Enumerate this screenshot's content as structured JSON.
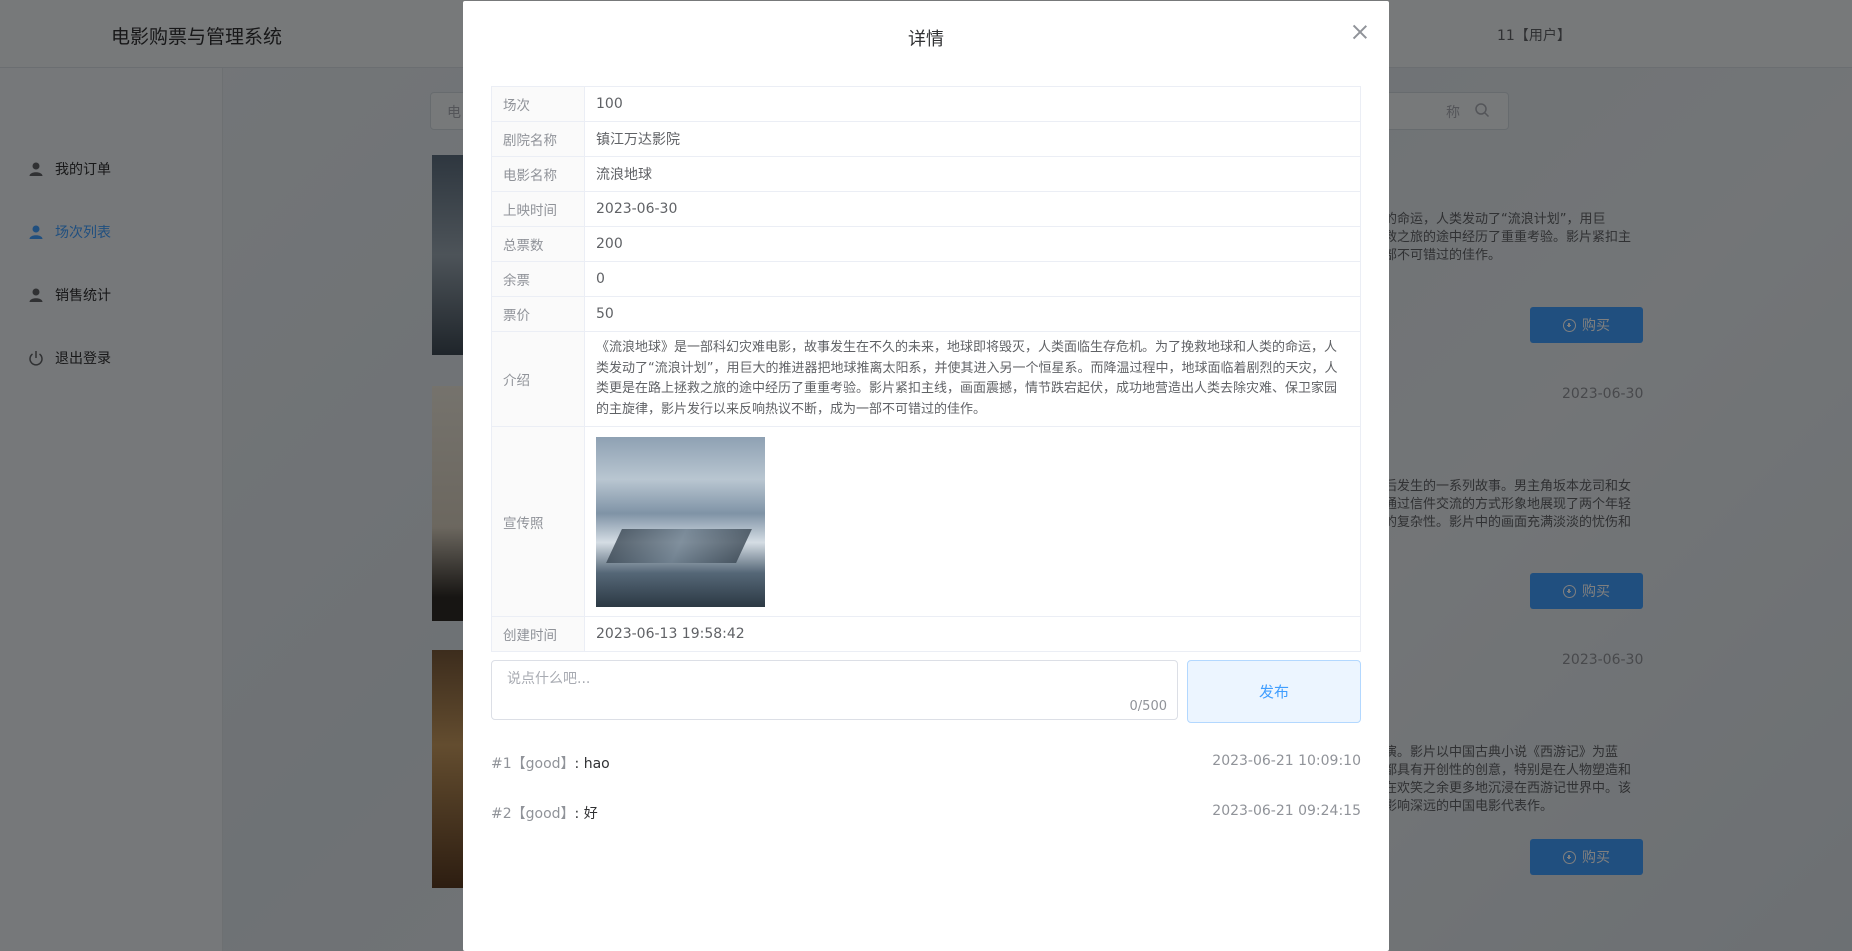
{
  "app": {
    "title": "电影购票与管理系统",
    "user": "11【用户】"
  },
  "sidebar": {
    "items": [
      {
        "label": "我的订单",
        "icon": "user-icon"
      },
      {
        "label": "场次列表",
        "icon": "user-icon",
        "active": true
      },
      {
        "label": "销售统计",
        "icon": "user-icon"
      },
      {
        "label": "退出登录",
        "icon": "power-icon"
      }
    ]
  },
  "background": {
    "search_placeholder_left": "电",
    "search_placeholder_right": "称",
    "buy_label": "购买",
    "movies": [
      {
        "desc": "的命运，人类发动了“流浪计划”，用巨\n救之旅的途中经历了重重考验。影片紧扣主\n部不可错过的佳作。"
      },
      {
        "date": "2023-06-30",
        "desc": "后发生的一系列故事。男主角坂本龙司和女\n通过信件交流的方式形象地展现了两个年轻\n的复杂性。影片中的画面充满淡淡的忧伤和"
      },
      {
        "date": "2023-06-30",
        "desc": "演。影片以中国古典小说《西游记》为蓝\n都具有开创性的创意，特别是在人物塑造和\n在欢笑之余更多地沉浸在西游记世界中。该\n影响深远的中国电影代表作。"
      }
    ]
  },
  "dialog": {
    "title": "详情",
    "details": {
      "session_label": "场次",
      "session": "100",
      "theater_label": "剧院名称",
      "theater": "镇江万达影院",
      "movie_label": "电影名称",
      "movie": "流浪地球",
      "release_label": "上映时间",
      "release": "2023-06-30",
      "total_label": "总票数",
      "total": "200",
      "remain_label": "余票",
      "remain": "0",
      "price_label": "票价",
      "price": "50",
      "intro_label": "介绍",
      "intro": "《流浪地球》是一部科幻灾难电影，故事发生在不久的未来，地球即将毁灭，人类面临生存危机。为了挽救地球和人类的命运，人类发动了“流浪计划”，用巨大的推进器把地球推离太阳系，并使其进入另一个恒星系。而降温过程中，地球面临着剧烈的天灾，人类更是在路上拯救之旅的途中经历了重重考验。影片紧扣主线，画面震撼，情节跌宕起伏，成功地营造出人类去除灾难、保卫家园的主旋律，影片发行以来反响热议不断，成为一部不可错过的佳作。",
      "photo_label": "宣传照",
      "created_label": "创建时间",
      "created": "2023-06-13 19:58:42"
    },
    "comment": {
      "placeholder": "说点什么吧...",
      "count": "0/500",
      "publish_label": "发布"
    },
    "comments": [
      {
        "index": "#1",
        "user": "【good】",
        "text": ": hao",
        "time": "2023-06-21 10:09:10"
      },
      {
        "index": "#2",
        "user": "【good】",
        "text": ": 好",
        "time": "2023-06-21 09:24:15"
      }
    ]
  }
}
